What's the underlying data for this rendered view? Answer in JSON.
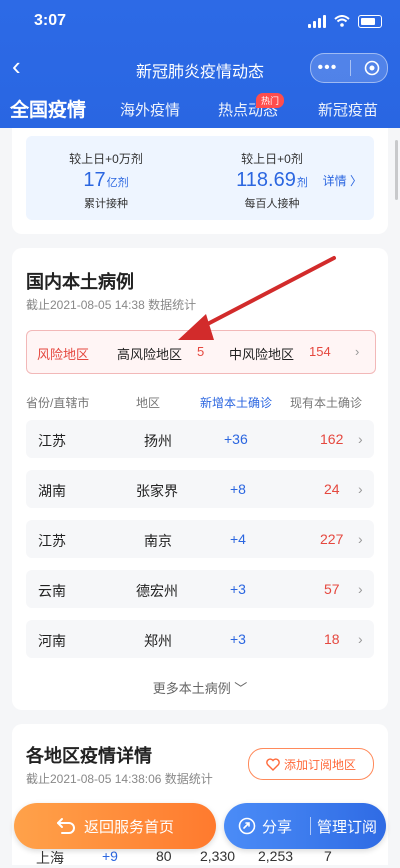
{
  "status_bar": {
    "time": "3:07"
  },
  "nav": {
    "title": "新冠肺炎疫情动态"
  },
  "tabs": [
    {
      "label": "全国疫情"
    },
    {
      "label": "海外疫情"
    },
    {
      "label": "热点动态",
      "badge": "热门"
    },
    {
      "label": "新冠疫苗"
    }
  ],
  "vaccine": {
    "cumulative_delta": "较上日+0万剂",
    "cumulative_value": "17",
    "cumulative_unit": "亿剂",
    "cumulative_label": "累计接种",
    "per100_delta": "较上日+0剂",
    "per100_value": "118.69",
    "per100_unit": "剂",
    "per100_label": "每百人接种",
    "detail_link": "详情 〉"
  },
  "local": {
    "title": "国内本土病例",
    "subtitle": "截止2021-08-05 14:38 数据统计",
    "risk": {
      "label": "风险地区",
      "high_label": "高风险地区",
      "high_count": "5",
      "mid_label": "中风险地区",
      "mid_count": "154"
    },
    "headers": {
      "province": "省份/直辖市",
      "area": "地区",
      "new_local": "新增本土确诊",
      "existing_local": "现有本土确诊"
    },
    "rows": [
      {
        "province": "江苏",
        "area": "扬州",
        "new": "+36",
        "existing": "162"
      },
      {
        "province": "湖南",
        "area": "张家界",
        "new": "+8",
        "existing": "24"
      },
      {
        "province": "江苏",
        "area": "南京",
        "new": "+4",
        "existing": "227"
      },
      {
        "province": "云南",
        "area": "德宏州",
        "new": "+3",
        "existing": "57"
      },
      {
        "province": "河南",
        "area": "郑州",
        "new": "+3",
        "existing": "18"
      }
    ],
    "more": "更多本土病例 ﹀"
  },
  "regions": {
    "title": "各地区疫情详情",
    "subtitle": "截止2021-08-05 14:38:06 数据统计",
    "subscribe": "添加订阅地区",
    "peek_row": {
      "province": "上海",
      "new": "+9",
      "c1": "80",
      "c2": "2,330",
      "c3": "2,253",
      "c4": "7"
    }
  },
  "bottom": {
    "home": "返回服务首页",
    "share": "分享",
    "manage": "管理订阅"
  },
  "colors": {
    "primary": "#2d6ae6",
    "risk_red": "#e5483f",
    "new_blue": "#2b66e0",
    "arrow_red": "#d22b2b"
  }
}
